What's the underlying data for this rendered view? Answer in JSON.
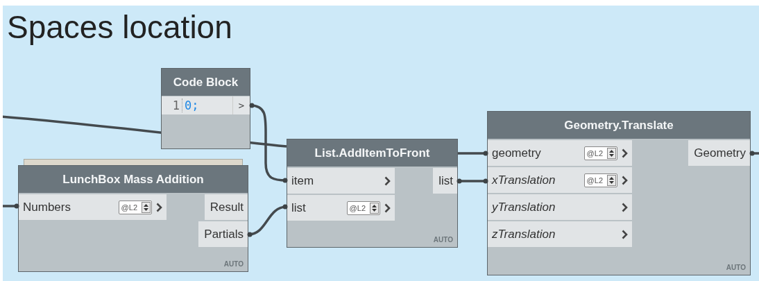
{
  "title": "Spaces location",
  "nodes": [
    {
      "kind": "code",
      "title": "Code Block",
      "line_number": "1",
      "code": "0;",
      "output": ">"
    },
    {
      "kind": "function",
      "title": "LunchBox Mass Addition",
      "stacked": true,
      "inputs": [
        {
          "name": "Numbers",
          "optional": false,
          "lacing": "@L2"
        }
      ],
      "outputs": [
        "Result",
        "Partials"
      ],
      "footer": "AUTO"
    },
    {
      "kind": "function",
      "title": "List.AddItemToFront",
      "stacked": false,
      "inputs": [
        {
          "name": "item",
          "optional": false
        },
        {
          "name": "list",
          "optional": false,
          "lacing": "@L2"
        }
      ],
      "outputs": [
        "list"
      ],
      "footer": "AUTO"
    },
    {
      "kind": "function",
      "title": "Geometry.Translate",
      "stacked": false,
      "inputs": [
        {
          "name": "geometry",
          "optional": false,
          "lacing": "@L2"
        },
        {
          "name": "xTranslation",
          "optional": true,
          "lacing": "@L2"
        },
        {
          "name": "yTranslation",
          "optional": true
        },
        {
          "name": "zTranslation",
          "optional": true
        }
      ],
      "outputs": [
        "Geometry"
      ],
      "footer": "AUTO"
    }
  ]
}
